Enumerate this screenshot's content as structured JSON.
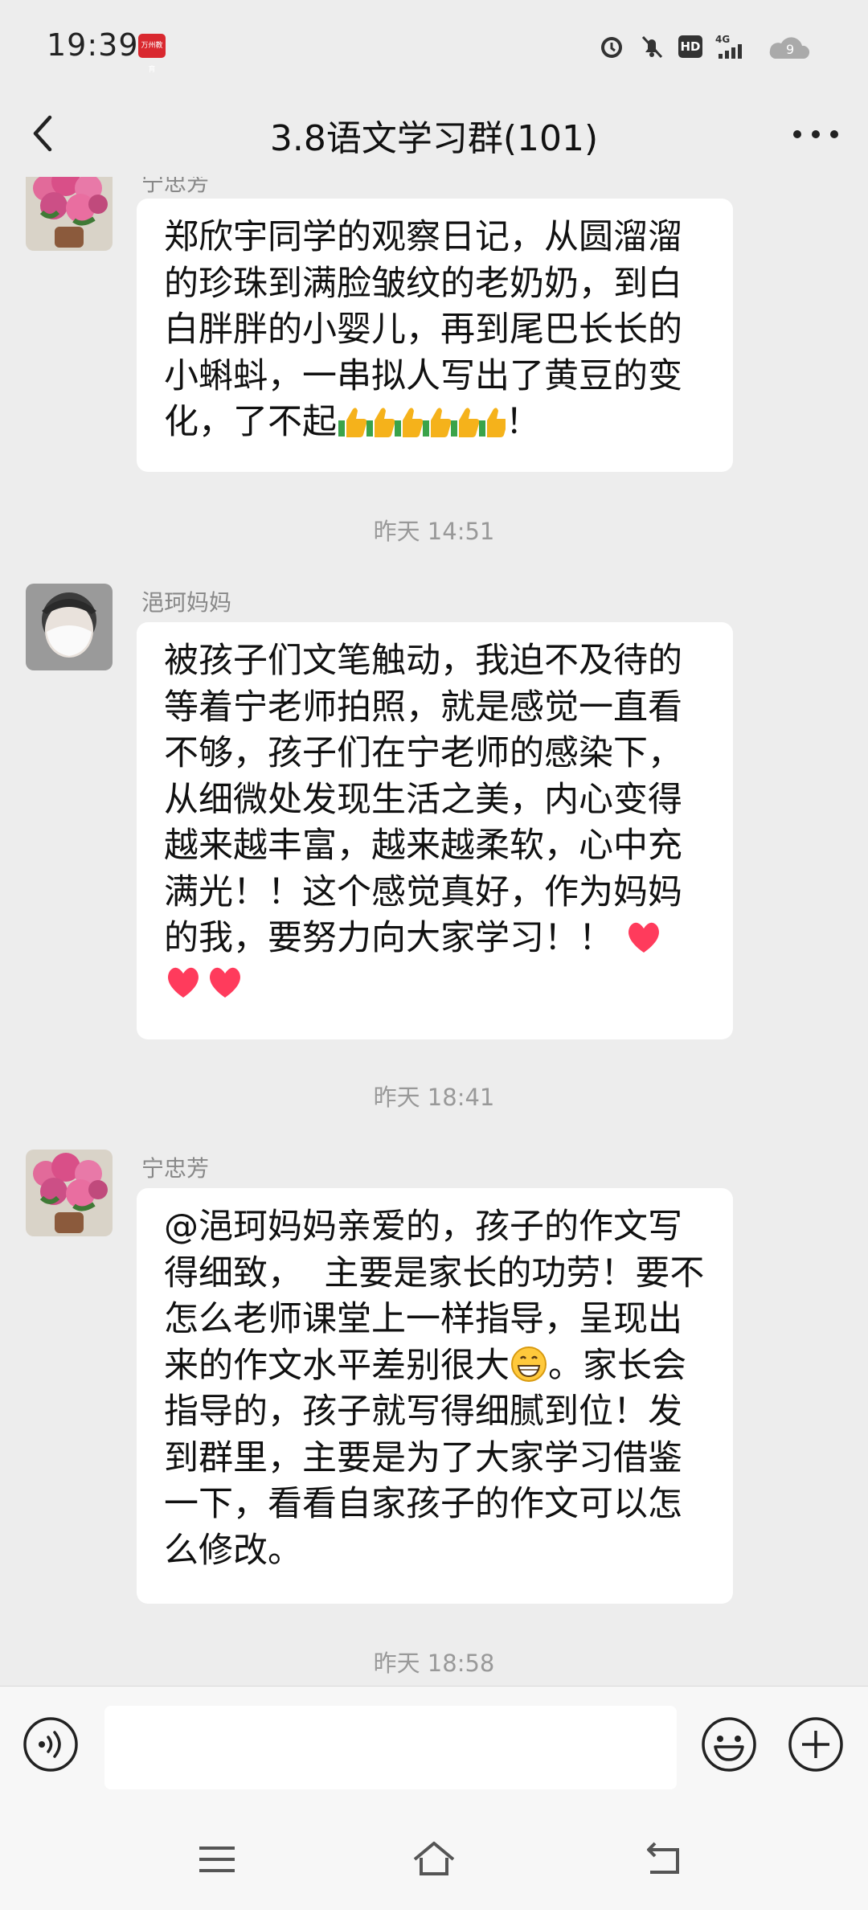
{
  "status_bar": {
    "time": "19:39",
    "app_badge": "万州教育",
    "network": "4G",
    "hd": "HD"
  },
  "header": {
    "title": "3.8语文学习群(101)"
  },
  "messages": [
    {
      "sender": "宁忠芳",
      "text": "郑欣宇同学的观察日记，从圆溜溜的珍珠到满脸皱纹的老奶奶，到白白胖胖的小婴儿，再到尾巴长长的小蝌蚪，一串拟人写出了黄豆的变化，了不起",
      "emoji_icon": "thumbs-up-icon",
      "emoji_count": 6,
      "suffix": "！"
    },
    {
      "timestamp": "昨天 14:51"
    },
    {
      "sender": "浥珂妈妈",
      "text": "被孩子们文笔触动，我迫不及待的等着宁老师拍照，就是感觉一直看不够，孩子们在宁老师的感染下，从细微处发现生活之美，内心变得越来越丰富，越来越柔软，心中充满光！！这个感觉真好，作为妈妈的我，要努力向大家学习！！",
      "emoji_icon": "heart-icon",
      "emoji_count": 3
    },
    {
      "timestamp": "昨天 18:41"
    },
    {
      "sender": "宁忠芳",
      "text_part1": "@浥珂妈妈亲爱的，孩子的作文写得细致，  主要是家长的功劳！要不怎么老师课堂上一样指导，呈现出来的作文水平差别很大",
      "emoji_icon": "grin-icon",
      "text_part2": "。家长会指导的，孩子就写得细腻到位！发到群里，主要是为了大家学习借鉴一下，看看自家孩子的作文可以怎么修改。"
    },
    {
      "timestamp": "昨天 18:58"
    }
  ],
  "input": {
    "value": "",
    "placeholder": ""
  },
  "colors": {
    "background": "#ededed",
    "bubble": "#ffffff",
    "timestamp": "#999999",
    "sender": "#888888",
    "heart": "#ff3b5c",
    "thumb": "#f5b21b"
  }
}
